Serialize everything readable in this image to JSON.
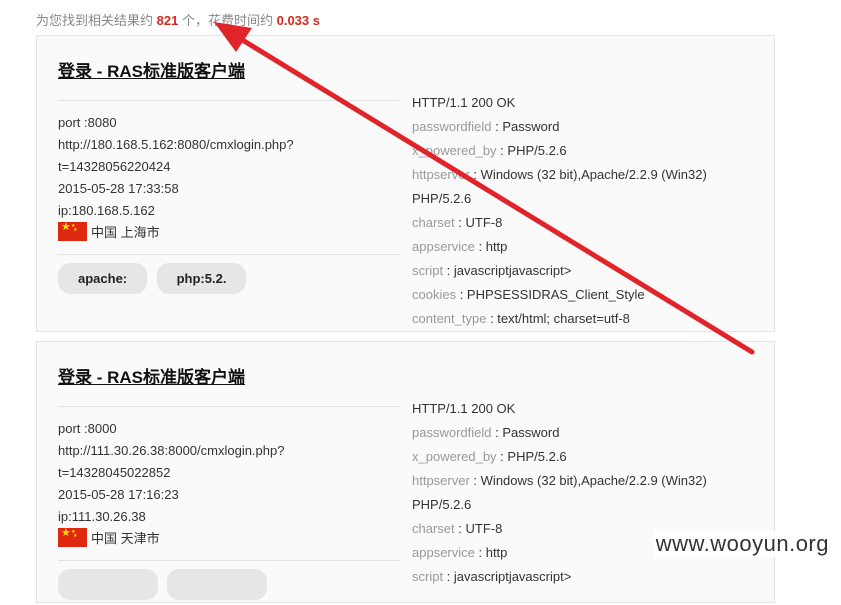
{
  "summary": {
    "prefix": "为您找到相关结果约",
    "count": "821",
    "middle": "个，花费时间约",
    "time": "0.033 s"
  },
  "results": [
    {
      "title": "登录 - RAS标准版客户端",
      "port": "port :8080",
      "url_line1": "http://180.168.5.162:8080/cmxlogin.php?",
      "url_line2": "t=14328056220424",
      "date": "2015-05-28 17:33:58",
      "ip": "ip:180.168.5.162",
      "location": "中国 上海市",
      "tags": [
        "apache:",
        "php:5.2."
      ],
      "headers": [
        {
          "key": "",
          "sep": "",
          "value": "HTTP/1.1 200 OK"
        },
        {
          "key": "passwordfield",
          "sep": " : ",
          "value": "Password"
        },
        {
          "key": "x_powered_by",
          "sep": " : ",
          "value": "PHP/5.2.6"
        },
        {
          "key": "httpserver",
          "sep": " : ",
          "value": "Windows (32 bit),Apache/2.2.9 (Win32)"
        },
        {
          "key": "",
          "sep": "",
          "value": "PHP/5.2.6"
        },
        {
          "key": "charset",
          "sep": " : ",
          "value": "UTF-8"
        },
        {
          "key": "appservice",
          "sep": " : ",
          "value": "http"
        },
        {
          "key": "script",
          "sep": " : ",
          "value": "javascriptjavascript>"
        },
        {
          "key": "cookies",
          "sep": " : ",
          "value": "PHPSESSIDRAS_Client_Style"
        },
        {
          "key": "content_type",
          "sep": " : ",
          "value": "text/html; charset=utf-8"
        }
      ]
    },
    {
      "title": "登录 - RAS标准版客户端",
      "port": "port :8000",
      "url_line1": "http://111.30.26.38:8000/cmxlogin.php?",
      "url_line2": "t=14328045022852",
      "date": "2015-05-28 17:16:23",
      "ip": "ip:111.30.26.38",
      "location": "中国 天津市",
      "tags": [
        "",
        ""
      ],
      "headers": [
        {
          "key": "",
          "sep": "",
          "value": "HTTP/1.1 200 OK"
        },
        {
          "key": "passwordfield",
          "sep": " : ",
          "value": "Password"
        },
        {
          "key": "x_powered_by",
          "sep": " : ",
          "value": "PHP/5.2.6"
        },
        {
          "key": "httpserver",
          "sep": " : ",
          "value": "Windows (32 bit),Apache/2.2.9 (Win32)"
        },
        {
          "key": "",
          "sep": "",
          "value": "PHP/5.2.6"
        },
        {
          "key": "charset",
          "sep": " : ",
          "value": "UTF-8"
        },
        {
          "key": "appservice",
          "sep": " : ",
          "value": "http"
        },
        {
          "key": "script",
          "sep": " : ",
          "value": "javascriptjavascript>"
        }
      ]
    }
  ],
  "watermark": "www.wooyun.org",
  "annotation": {
    "color": "#e0242a"
  }
}
